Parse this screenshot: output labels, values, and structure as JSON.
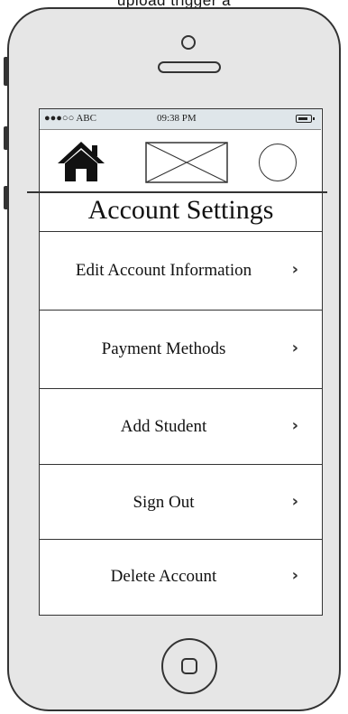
{
  "top_caption": "upload trigger a",
  "status_bar": {
    "carrier": "●●●○○ ABC",
    "time": "09:38 PM",
    "battery_icon": "battery-icon"
  },
  "header": {
    "home_icon": "home-icon",
    "image_placeholder": "image-placeholder-icon",
    "profile_icon": "profile-circle-icon"
  },
  "page_title": "Account Settings",
  "menu": {
    "chevron": "›",
    "items": [
      {
        "label": "Edit Account Information"
      },
      {
        "label": "Payment Methods"
      },
      {
        "label": "Add Student"
      },
      {
        "label": "Sign Out"
      },
      {
        "label": "Delete Account"
      }
    ]
  },
  "colors": {
    "phone_body": "#e6e6e6",
    "outline": "#333333",
    "status_bar": "#dfe6ea"
  }
}
